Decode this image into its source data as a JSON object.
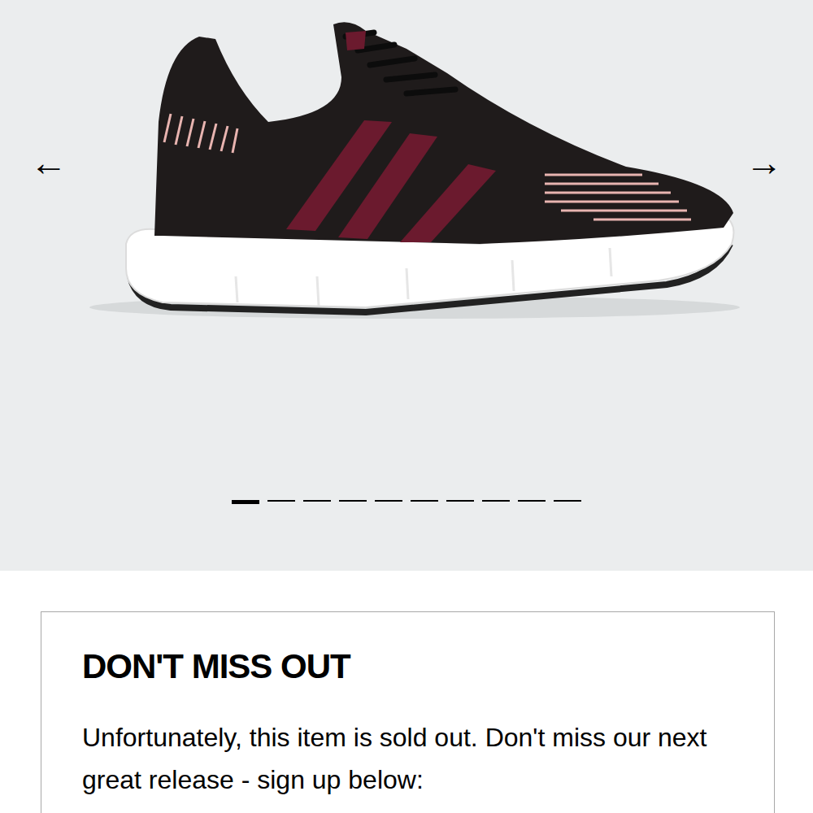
{
  "carousel": {
    "prev": "←",
    "next": "→",
    "slides": [
      {
        "selected": true
      },
      {
        "selected": false
      },
      {
        "selected": false
      },
      {
        "selected": false
      },
      {
        "selected": false
      },
      {
        "selected": false
      },
      {
        "selected": false
      },
      {
        "selected": false
      },
      {
        "selected": false
      },
      {
        "selected": false
      }
    ]
  },
  "notice": {
    "title": "DON'T MISS OUT",
    "text": "Unfortunately, this item is sold out. Don't miss our next great release - sign up below:"
  }
}
